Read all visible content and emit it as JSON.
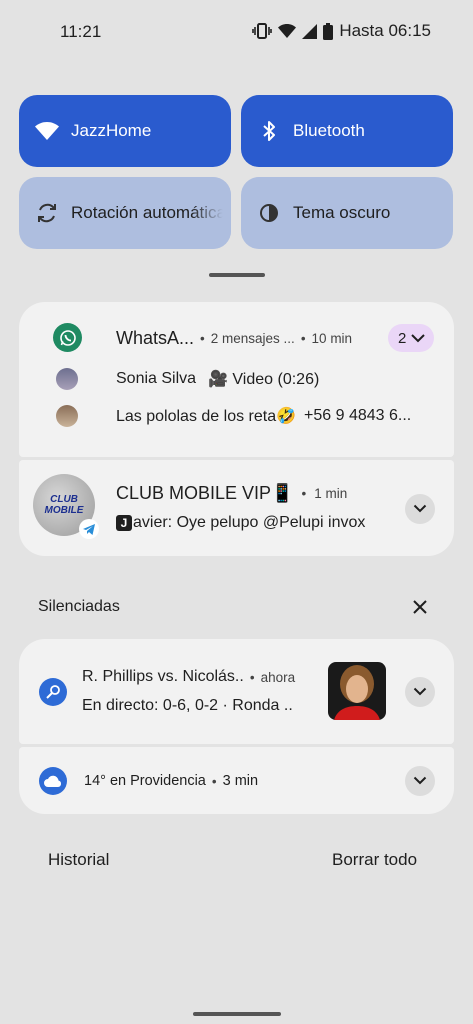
{
  "status_bar": {
    "time": "11:21",
    "alarm_text": "Hasta 06:15"
  },
  "quick_settings": {
    "tiles": [
      {
        "label": "JazzHome",
        "icon": "wifi-icon",
        "state": "on"
      },
      {
        "label": "Bluetooth",
        "icon": "bluetooth-icon",
        "state": "on"
      },
      {
        "label": "Rotación automática",
        "icon": "auto-rotate-icon",
        "state": "off"
      },
      {
        "label": "Tema oscuro",
        "icon": "dark-theme-icon",
        "state": "off"
      }
    ]
  },
  "whatsapp": {
    "app_name": "WhatsA...",
    "summary": "2 mensajes ...",
    "time": "10 min",
    "count": "2",
    "messages": [
      {
        "sender": "Sonia Silva",
        "text": "🎥 Video (0:26)"
      },
      {
        "sender": "Las pololas de los reta🤣",
        "text": "+56 9 4843 6..."
      }
    ]
  },
  "telegram": {
    "title": "CLUB MOBILE VIP📱",
    "time": "1 min",
    "avatar_text": "CLUB MOBILE",
    "message_icon": "J",
    "message": "avier: Oye pelupo @Pelupi invox"
  },
  "silenced": {
    "header": "Silenciadas",
    "sports": {
      "title": "R. Phillips vs. Nicolás..",
      "time": "ahora",
      "text": "En directo: 0-6, 0-2 · Ronda .."
    },
    "weather": {
      "text": "14° en Providencia",
      "time": "3 min"
    }
  },
  "footer": {
    "history": "Historial",
    "clear_all": "Borrar todo"
  },
  "colors": {
    "tile_on": "#2a5bce",
    "tile_off": "#aebedf",
    "whatsapp_green": "#1f8a62",
    "notification_blue": "#2e6bd6",
    "count_pill": "#ead6f7"
  }
}
